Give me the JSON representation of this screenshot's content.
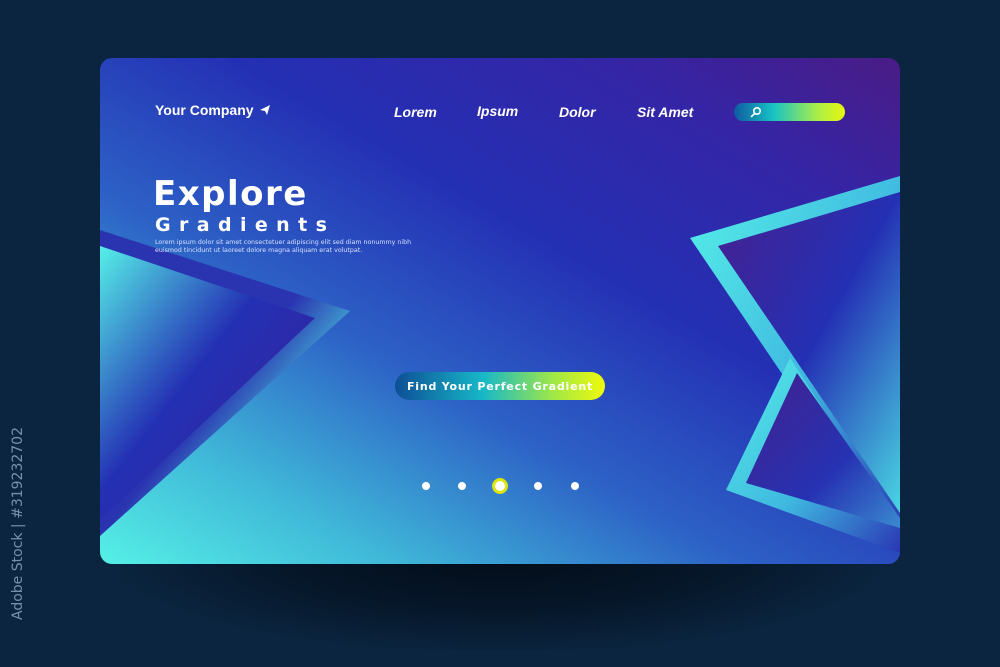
{
  "header": {
    "brand": "Your Company",
    "brand_icon": "paper-plane-icon",
    "nav": [
      "Lorem",
      "Ipsum",
      "Dolor",
      "Sit Amet"
    ],
    "search": {
      "icon": "search-icon",
      "placeholder": ""
    }
  },
  "hero": {
    "title": "Explore",
    "subtitle": "Gradients",
    "body_line1": "Lorem ipsum dolor sit amet  consectetuer adipiscing elit  sed diam nonummy nibh",
    "body_line2": "euismod tincidunt ut laoreet dolore magna aliquam erat volutpat.",
    "cta_label": "Find Your Perfect Gradient"
  },
  "carousel": {
    "total": 5,
    "active_index": 2
  },
  "watermark": {
    "side_text": "Adobe Stock | #319232702"
  },
  "colors": {
    "page_bg": "#0b2540",
    "card_purple": "#4a1c86",
    "card_blue": "#2430b4",
    "card_cyan": "#55f0e6",
    "accent_yellow": "#e8f70f",
    "accent_teal": "#17b8c8"
  }
}
